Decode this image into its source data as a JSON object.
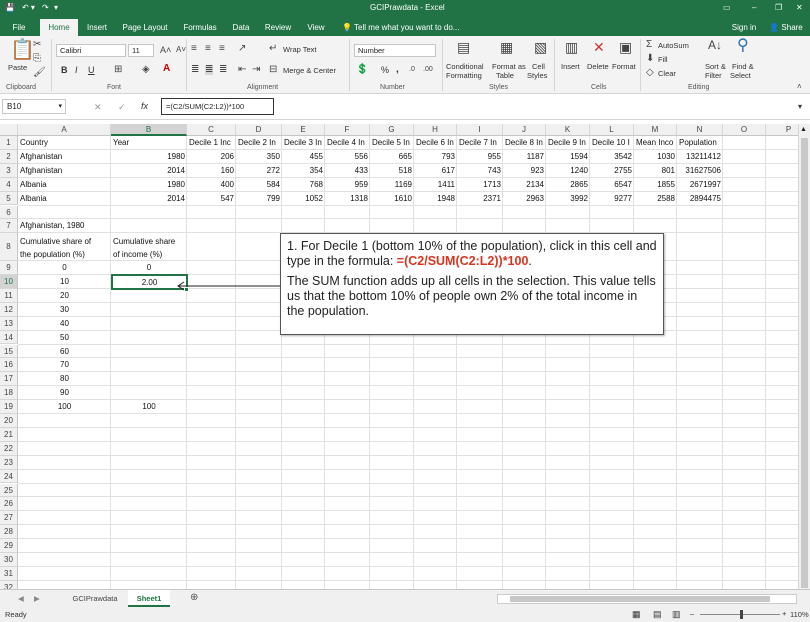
{
  "window": {
    "title": "GCIPrawdata - Excel",
    "controls": [
      "–",
      "❐",
      "✕"
    ]
  },
  "tabs": [
    "File",
    "Home",
    "Insert",
    "Page Layout",
    "Formulas",
    "Data",
    "Review",
    "View"
  ],
  "tell_me": "Tell me what you want to do...",
  "account": {
    "signin": "Sign in",
    "share": "Share"
  },
  "ribbon": {
    "clipboard": {
      "label": "Clipboard",
      "paste": "Paste"
    },
    "font": {
      "label": "Font",
      "name": "Calibri",
      "size": "11",
      "bold": "B",
      "italic": "I",
      "underline": "U"
    },
    "alignment": {
      "label": "Alignment",
      "wrap": "Wrap Text",
      "merge": "Merge & Center"
    },
    "number": {
      "label": "Number",
      "format": "Number",
      "percent": "%",
      "comma": ","
    },
    "styles": {
      "label": "Styles",
      "cond": [
        "Conditional",
        "Formatting"
      ],
      "table": [
        "Format as",
        "Table"
      ],
      "cell": [
        "Cell",
        "Styles"
      ]
    },
    "cells": {
      "label": "Cells",
      "insert": "Insert",
      "delete": "Delete",
      "format": "Format"
    },
    "editing": {
      "label": "Editing",
      "autosum": "AutoSum",
      "fill": "Fill",
      "clear": "Clear",
      "sort": [
        "Sort &",
        "Filter"
      ],
      "find": [
        "Find &",
        "Select"
      ]
    }
  },
  "namebox": "B10",
  "formula_text": "=(C2/SUM(C2:L2))*100",
  "columns": [
    "A",
    "B",
    "C",
    "D",
    "E",
    "F",
    "G",
    "H",
    "I",
    "J",
    "K",
    "L",
    "M",
    "N",
    "O",
    "P"
  ],
  "rows": [
    "1",
    "2",
    "3",
    "4",
    "5",
    "6",
    "7",
    "8",
    "9",
    "10",
    "11",
    "12",
    "13",
    "14",
    "15",
    "16",
    "17",
    "18",
    "19",
    "20",
    "21",
    "22",
    "23",
    "24",
    "25",
    "26",
    "27",
    "28",
    "29",
    "30",
    "31",
    "32"
  ],
  "header_row": [
    "Country",
    "Year",
    "Decile 1 Inc",
    "Decile 2 In",
    "Decile 3 In",
    "Decile 4 In",
    "Decile 5 In",
    "Decile 6 In",
    "Decile 7 In",
    "Decile 8 In",
    "Decile 9 In",
    "Decile 10 I",
    "Mean Inco",
    "Population"
  ],
  "data_rows": [
    [
      "Afghanistan",
      "1980",
      "206",
      "350",
      "455",
      "556",
      "665",
      "793",
      "955",
      "1187",
      "1594",
      "3542",
      "1030",
      "13211412"
    ],
    [
      "Afghanistan",
      "2014",
      "160",
      "272",
      "354",
      "433",
      "518",
      "617",
      "743",
      "923",
      "1240",
      "2755",
      "801",
      "31627506"
    ],
    [
      "Albania",
      "1980",
      "400",
      "584",
      "768",
      "959",
      "1169",
      "1411",
      "1713",
      "2134",
      "2865",
      "6547",
      "1855",
      "2671997"
    ],
    [
      "Albania",
      "2014",
      "547",
      "799",
      "1052",
      "1318",
      "1610",
      "1948",
      "2371",
      "2963",
      "3992",
      "9277",
      "2588",
      "2894475"
    ]
  ],
  "a7": "Afghanistan, 1980",
  "a8": [
    "Cumulative share of",
    "the population (%)"
  ],
  "b8": [
    "Cumulative share",
    "of income (%)"
  ],
  "pop_col": [
    "0",
    "10",
    "20",
    "30",
    "40",
    "50",
    "60",
    "70",
    "80",
    "90",
    "100"
  ],
  "b9": "0",
  "b10": "2.00",
  "b19": "100",
  "callout": {
    "line1": "1. For Decile 1 (bottom 10% of the population), click in this cell and type in the formula: ",
    "formula": "=(C2/SUM(C2:L2))*100",
    "line1_end": ".",
    "line2": "The SUM function adds up all cells in the selection. This value tells us that the bottom 10% of people own 2% of the total income in the population."
  },
  "sheets": [
    "GCIPrawdata",
    "Sheet1"
  ],
  "status": {
    "ready": "Ready",
    "zoom": "110%"
  }
}
